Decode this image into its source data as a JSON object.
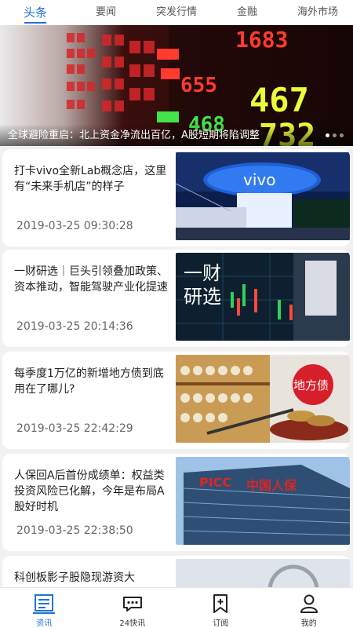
{
  "tabs": [
    {
      "label": "头条",
      "active": true
    },
    {
      "label": "要闻",
      "active": false
    },
    {
      "label": "突发行情",
      "active": false
    },
    {
      "label": "金融",
      "active": false
    },
    {
      "label": "海外市场",
      "active": false
    }
  ],
  "banner": {
    "caption": "全球避险重启：北上资金净流出百亿，A股短期将陷调整",
    "board_numbers": [
      "1683",
      "467",
      "732",
      "468",
      "655"
    ]
  },
  "articles": [
    {
      "title": "打卡vivo全新Lab概念店，这里有“未来手机店”的样子",
      "time": "2019-03-25 09:30:28",
      "image_text": "vivo"
    },
    {
      "title": "一财研选｜巨头引领叠加政策、资本推动，智能驾驶产业化提速",
      "time": "2019-03-25 20:14:36",
      "image_text_1": "一财",
      "image_text_2": "研选"
    },
    {
      "title": "每季度1万亿的新增地方债到底用在了哪儿?",
      "time": "2019-03-25 22:42:29",
      "image_text": "地方债"
    },
    {
      "title": "人保回A后首份成绩单：权益类投资风险已化解，今年是布局A股好时机",
      "time": "2019-03-25 22:38:50",
      "image_text_1": "PICC",
      "image_text_2": "中国人保"
    },
    {
      "title": "科创板影子股隐现游资大",
      "time": ""
    }
  ],
  "bottom_nav": [
    {
      "label": "资讯",
      "icon": "news-icon",
      "active": true
    },
    {
      "label": "24快讯",
      "icon": "chat-bubble-icon",
      "active": false
    },
    {
      "label": "订阅",
      "icon": "bookmark-plus-icon",
      "active": false
    },
    {
      "label": "我的",
      "icon": "user-icon",
      "active": false
    }
  ],
  "colors": {
    "accent": "#1f73d8"
  }
}
